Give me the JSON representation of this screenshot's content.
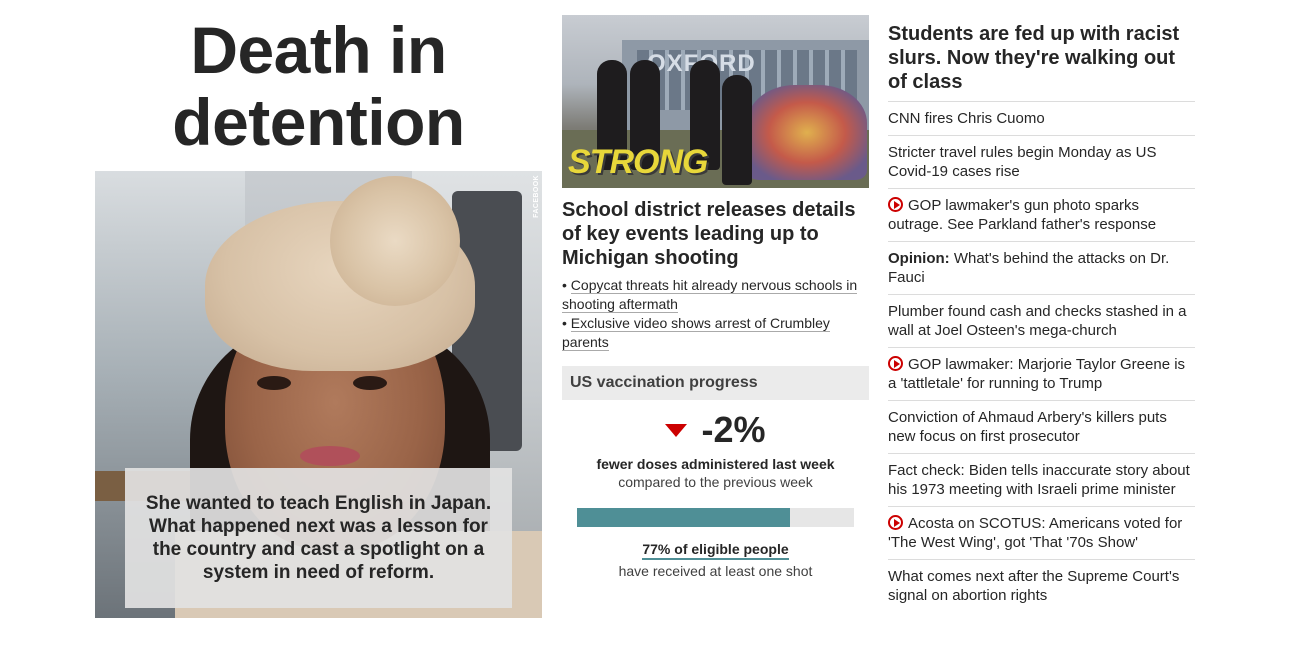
{
  "left": {
    "headline": "Death in detention",
    "photo_credit": "FACEBOOK",
    "caption": "She wanted to teach English in Japan. What happened next was a lesson for the country and cast a spotlight on a system in need of reform."
  },
  "middle": {
    "image_sign_text": "OXFORD",
    "image_strong_text": "STRONG",
    "headline": "School district releases details of key events leading up to Michigan shooting",
    "sub_links": [
      "Copycat threats hit already nervous schools in shooting aftermath",
      "Exclusive video shows arrest of Crumbley parents"
    ],
    "vaccination": {
      "title": "US vaccination progress",
      "change": "-2%",
      "change_direction": "down",
      "change_label": "fewer doses administered last week",
      "change_sub": "compared to the previous week",
      "eligible_fraction": 0.77,
      "eligible_label": "77% of eligible people",
      "eligible_sub": "have received at least one shot",
      "bar_color": "#4f8f96",
      "arrow_color": "#cc0000"
    }
  },
  "right": {
    "headline": "Students are fed up with racist slurs. Now they're walking out of class",
    "items": [
      {
        "text": "CNN fires Chris Cuomo",
        "video": false,
        "prefix": ""
      },
      {
        "text": "Stricter travel rules begin Monday as US Covid-19 cases rise",
        "video": false,
        "prefix": ""
      },
      {
        "text": "GOP lawmaker's gun photo sparks outrage. See Parkland father's response",
        "video": true,
        "prefix": ""
      },
      {
        "text": " What's behind the attacks on Dr. Fauci",
        "video": false,
        "prefix": "Opinion:"
      },
      {
        "text": "Plumber found cash and checks stashed in a wall at Joel Osteen's mega-church",
        "video": false,
        "prefix": ""
      },
      {
        "text": "GOP lawmaker: Marjorie Taylor Greene is a 'tattletale' for running to Trump",
        "video": true,
        "prefix": ""
      },
      {
        "text": "Conviction of Ahmaud Arbery's killers puts new focus on first prosecutor",
        "video": false,
        "prefix": ""
      },
      {
        "text": "Fact check: Biden tells inaccurate story about his 1973 meeting with Israeli prime minister",
        "video": false,
        "prefix": ""
      },
      {
        "text": "Acosta on SCOTUS: Americans voted for 'The West Wing', got 'That '70s Show'",
        "video": true,
        "prefix": ""
      },
      {
        "text": "What comes next after the Supreme Court's signal on abortion rights",
        "video": false,
        "prefix": ""
      }
    ]
  }
}
